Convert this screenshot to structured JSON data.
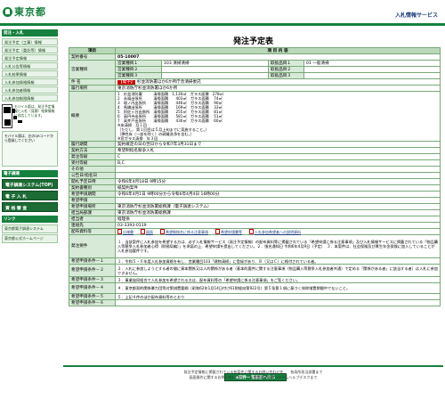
{
  "header": {
    "logo_text": "東京都",
    "system_name": "入札情報サービス"
  },
  "sidebar": {
    "section1_title": "発注・入札",
    "items": [
      "発注予定（工事）情報",
      "発注予定（委託等）情報",
      "発注予定情報",
      "入札公告等情報",
      "入札結果情報",
      "入札参加資格情報",
      "入札参加者情報",
      "入札参加制限情報"
    ],
    "qr_text": "モバイル版は、発注予定情報と入札（見積）結果情報に対応しています。",
    "mobile_text": "モバイル版は、左のQRコードから登録してください",
    "section2_title": "電子調達",
    "big_buttons": [
      "電子調達システム(TOP)",
      "電 子 入 札",
      "資 格 審 査"
    ],
    "section3_title": "リンク",
    "links": [
      "東京都電子調達システム",
      "東京都公式ホームページ"
    ]
  },
  "page_title": "発注予定表",
  "table": {
    "col_item": "項目",
    "col_content": "項 目 内 容",
    "rows": {
      "keiyaku_no": {
        "label": "契約番号",
        "value": "05-10007"
      },
      "eigyo1": {
        "label": "営業種目",
        "sub1": "営業種目１",
        "sub1v": "103 清掃清掃",
        "sub2": "取扱品目１",
        "sub2v": "01 一般清掃"
      },
      "eigyo2": {
        "sub1": "営業種目２",
        "sub2": "取扱品目２"
      },
      "eigyo3": {
        "sub1": "営業種目３",
        "sub2": "取扱品目３"
      },
      "kenmei": {
        "label": "件 名",
        "tag": "【電子】",
        "value": "杉並消防署ほか6か所庁舎清掃委託"
      },
      "basho": {
        "label": "履行場所",
        "value": "東京消防庁杉並消防署ほか6か所"
      },
      "gaiyo": {
        "label": "概要",
        "lines": [
          "1　杉並消防署　　　清掃面積　1,130㎡　ガラス面積　278㎡",
          "2　永福出張所　　　清掃面積　　403㎡　ガラス面積　 74㎡",
          "3　堀ノ内出張所　　清掃面積　　446㎡　ガラス面積　 90㎡",
          "4　馬橋出張所　　　清掃面積　　169㎡　ガラス面積　 33㎡",
          "5　阿佐ヶ谷出張所　清掃面積　　255㎡　ガラス面積　 81㎡",
          "6　高円寺出張所　　清掃面積　　581㎡　ガラス面積　 51㎡",
          "7　高井戸出張所　　清掃面積　　430㎡　ガラス面積　 60㎡",
          "※床清掃　月１回",
          "（ただし、第１回目は５月上旬までに実施すること。）",
          "（弾性床（一部を除く）の剥離洗浄を含む。）",
          "※窓ガラス清掃　年３回"
        ]
      },
      "kikan": {
        "label": "履行期間",
        "value": "契約確定の日の翌日から令和7年3月31日まで"
      },
      "hoshiki": {
        "label": "契約方法",
        "value": "希望制指名競争入札"
      },
      "kakusa": {
        "label": "発注等級",
        "value": "C"
      },
      "uketsuke": {
        "label": "受付等級",
        "value": "B,C"
      },
      "sonota": {
        "label": "その他",
        "value": ""
      },
      "kokokubi": {
        "label": "公告日/指名日",
        "value": ""
      },
      "kaishi": {
        "label": "開札予定日時",
        "value": "令和6年4月18日 9時15分"
      },
      "kibou_keishiki": {
        "label": "契約書種別",
        "value": "紙契約案件"
      },
      "kibou_kikan": {
        "label": "希望申請期間",
        "value": "令和6年4月1日 9時00分から令和6年4月4日 16時00分"
      },
      "kibou_teishutsu": {
        "label": "希望申請",
        "value": ""
      },
      "kibou_basho": {
        "label": "希望申請場所",
        "value": "東京消防庁杉並消防署総務課（電子調達システム）"
      },
      "tanto": {
        "label": "担当局部課",
        "value": "東京消防庁杉並消防署総務課"
      },
      "tantosha": {
        "label": "担当者",
        "value": "経理係"
      },
      "tel": {
        "label": "連絡先",
        "value": "03-3393-0119"
      },
      "docs": {
        "label": "配布資料等",
        "items": [
          "仕様書",
          "図面",
          "希望制指名に係る注意事項",
          "希望申請書等",
          "入札参加希望者への説明資料"
        ]
      },
      "jouken1": {
        "label": "発注要件",
        "value": "１．当該案件に入札参加を希望する方は、必ず入札情報サービス（発注予定情報）の配布資料等に掲載されている「希望申請に係る注意事項」及び入札情報サービスに掲載されている「物品購入等競争入札参加者心得（財務局編）」を承諾の上、希望申請を提出してください。２．指名通知日 令和6年4月9日（予定）　３．本案件は、社会保険及び厚生年金保険に加入していることが入札参加要件です。"
      },
      "j1": {
        "label": "希望申請条件－１",
        "value": "１．令和５・６年度入札参加資格を有し、営業種目103「建物清掃」に登録があり、Ｂ（又はＣ）に格付されている者。"
      },
      "j2": {
        "label": "希望申請条件－２",
        "value": "２．入札に参加しようとする者の間に資本関係又は人的関係がある者（基本的要件に関する注意事項（物品購入等競争入札参加者共通）で定める「関係がある者」に該当する者）は入札に参加できません。"
      },
      "j3": {
        "label": "希望申請条件－３",
        "value": "３．事業協同組合で入札参加を希望される方は、配布資料等の「希望申請に係る注意事項」をご覧ください。"
      },
      "j4": {
        "label": "希望申請条件－４",
        "value": "４．東京都契約関係暴力団等対策措置要綱（昭和62年1月14日付け61財経庶第922号）第５条第１項に基づく排除措置期間中でないこと。"
      },
      "j5": {
        "label": "希望申請条件－５",
        "value": "５．上記４件のほか配布資料等のとおり"
      },
      "j6": {
        "label": "希望申請条件－６",
        "value": ""
      }
    }
  },
  "list_button": "◆案件一覧画面へ戻る",
  "footer": {
    "line1": "発注予定情報に掲載されている各案件に関するお問い合わせ先　　各局所担当部署まで",
    "line2": "画面操作に関するお問い合わせ先　　東京都電子調達システムヘルプデスクまで"
  }
}
